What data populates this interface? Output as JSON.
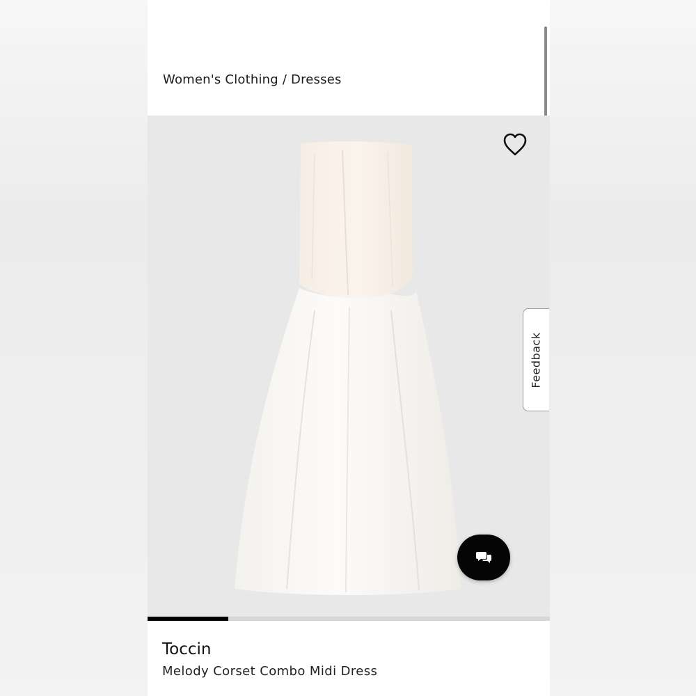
{
  "breadcrumb": {
    "text": "Women's Clothing / Dresses"
  },
  "product": {
    "brand": "Toccin",
    "name": "Melody Corset Combo Midi Dress",
    "image_background": "#e8e8e8"
  },
  "feedback": {
    "label": "Feedback"
  },
  "icons": {
    "wishlist": "heart-outline-icon",
    "chat": "chat-bubbles-icon"
  },
  "carousel": {
    "progress": 0.2
  },
  "colors": {
    "accent": "#000000",
    "track": "#d6d6d6"
  }
}
